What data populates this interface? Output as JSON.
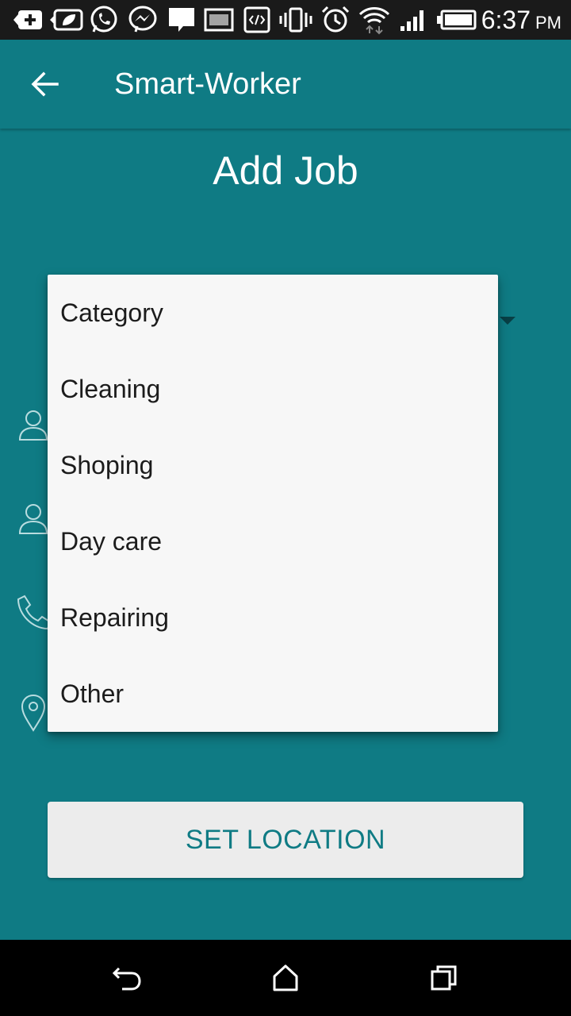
{
  "status_bar": {
    "time": "6:37",
    "ampm": "PM",
    "icons": [
      "add-box-icon",
      "leaf-notification-icon",
      "whatsapp-icon",
      "messenger-icon",
      "message-icon",
      "image-icon",
      "code-icon",
      "vibrate-icon",
      "alarm-icon",
      "wifi-icon",
      "signal-icon",
      "battery-icon"
    ]
  },
  "app_bar": {
    "title": "Smart-Worker",
    "back_icon": "arrow-back-icon"
  },
  "page": {
    "title": "Add Job"
  },
  "dropdown": {
    "items": [
      "Category",
      "Cleaning",
      "Shoping",
      "Day care",
      "Repairing",
      "Other"
    ]
  },
  "side_icons": [
    "person-icon",
    "person-icon",
    "phone-icon",
    "location-pin-icon"
  ],
  "buttons": {
    "set_location": "SET LOCATION"
  },
  "nav_bar": {
    "icons": [
      "back-icon",
      "home-icon",
      "recents-icon"
    ]
  },
  "colors": {
    "primary": "#0f7b84",
    "status_bar": "#1a1a1a",
    "dropdown_bg": "#f7f7f7",
    "button_bg": "#ececec"
  }
}
